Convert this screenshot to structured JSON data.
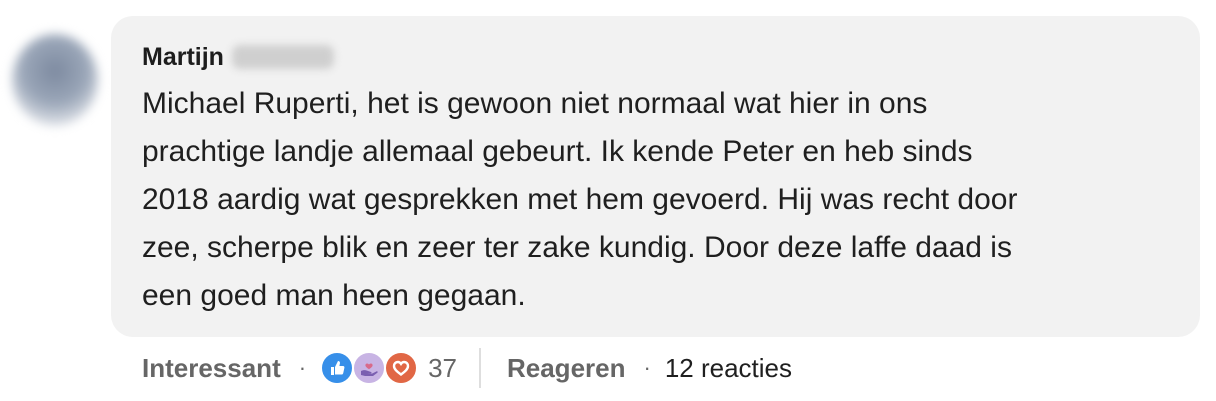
{
  "comment": {
    "author_name": "Martijn",
    "text_lines": [
      "Michael Ruperti, het is gewoon niet normaal wat hier in ons",
      "prachtige landje allemaal gebeurt. Ik kende Peter en heb sinds",
      "2018 aardig wat gesprekken met hem gevoerd. Hij was recht door",
      "zee, scherpe blik en zeer ter zake kundig. Door deze laffe daad is",
      "een goed man heen gegaan."
    ]
  },
  "actions": {
    "react_label": "Interessant",
    "separator": "·",
    "reaction_icons": [
      "like-icon",
      "support-icon",
      "love-icon"
    ],
    "reaction_count": "37",
    "reply_label": "Reageren",
    "replies_count": "12 reacties"
  },
  "colors": {
    "bubble_background": "#f2f2f2",
    "like": "#378fe9",
    "support": "#c8b4e4",
    "love": "#e16745",
    "muted_text": "#666666"
  }
}
